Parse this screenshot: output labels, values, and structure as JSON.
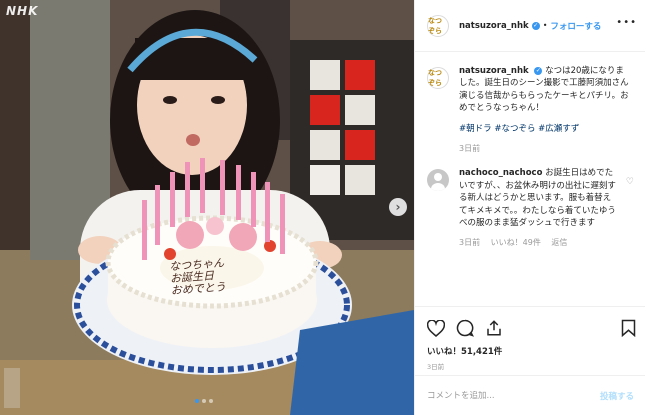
{
  "photo": {
    "watermark": "NHK",
    "cake_text": [
      "なつちゃん",
      "お誕生日",
      "おめでとう"
    ]
  },
  "header": {
    "avatar_text": "なつぞら",
    "username": "natsuzora_nhk",
    "separator": "•",
    "follow_label": "フォローする",
    "more_label": "•••"
  },
  "caption": {
    "username": "natsuzora_nhk",
    "text": "なつは20歳になりました。誕生日のシーン撮影で工藤阿須加さん演じる信哉からもらったケーキとパチリ。おめでとうなっちゃん！",
    "hashtags": "#朝ドラ #なつぞら #広瀬すず",
    "time": "3日前"
  },
  "comment": {
    "username": "nachoco_nachoco",
    "text": "お誕生日はめでたいですが、、お盆休み明けの出社に遅刻する新人はどうかと思います。服も着替えてキメキメで。。わたしなら着ていたゆうべの服のまま猛ダッシュで行きます",
    "time": "3日前",
    "likes": "いいね！49件",
    "reply": "返信"
  },
  "actions": {
    "likes": "いいね！51,421件",
    "date": "3日前"
  },
  "add_comment": {
    "placeholder": "コメントを追加...",
    "post_label": "投稿する"
  },
  "colors": {
    "accent": "#3897f0",
    "post_disabled": "#b2dffc",
    "hashtag": "#003569"
  }
}
